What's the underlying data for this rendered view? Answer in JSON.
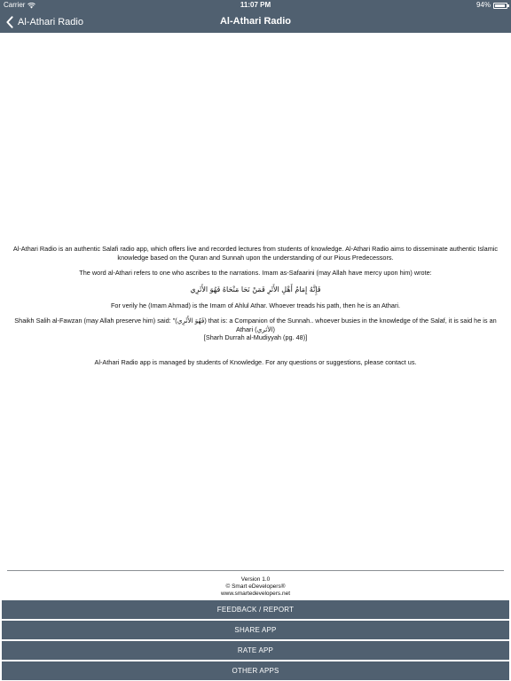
{
  "status_bar": {
    "carrier": "Carrier",
    "time": "11:07 PM",
    "battery": "94%",
    "icons": [
      "wifi-icon",
      "battery-icon"
    ]
  },
  "nav": {
    "back_label": "Al-Athari Radio",
    "title": "Al-Athari Radio",
    "back_icon": "chevron-left-icon"
  },
  "about": {
    "intro": "Al-Athari Radio is an authentic Salafi radio app, which offers live and recorded lectures from students of knowledge. Al-Athari Radio aims to disseminate authentic Islamic knowledge based on the Quran and Sunnah upon the understanding of our Pious Predecessors.",
    "definition": "The word al-Athari refers to one who ascribes to the narrations. Imam as-Safaarini (may Allah have mercy upon him) wrote:",
    "arabic_verse": "فَإِنَّهُ إِمَامُ أَهْلِ الأَثَرِ فَمَنْ نَحَا مَنْحَاهُ فَهُوَ الأَثَرِي",
    "translation": "For verily he (Imam Ahmad) is the Imam of Ahlul Athar. Whoever treads his path, then he is an Athari.",
    "fawzan_quote": "Shaikh Salih al-Fawzan (may Allah preserve him) said: \"(فَهُوَ الأَثَرِي) that is: a Companion of the Sunnah.. whoever busies in the knowledge of the Salaf, it is said he is an Athari (الأثري)",
    "citation": "[Sharh Durrah al-Mudiyyah (pg. 48)]",
    "managed_by": "Al-Athari Radio app is managed by students of Knowledge. For any questions or suggestions, please contact us."
  },
  "footer": {
    "version": "Version 1.0",
    "copyright": "© Smart eDevelopers®",
    "website": "www.smartedevelopers.net"
  },
  "buttons": {
    "feedback": "FEEDBACK / REPORT",
    "share": "SHARE APP",
    "rate": "RATE APP",
    "other": "OTHER APPS"
  },
  "colors": {
    "bar_bg": "#506070",
    "button_bg": "#506070",
    "text": "#111111",
    "background": "#ffffff"
  }
}
